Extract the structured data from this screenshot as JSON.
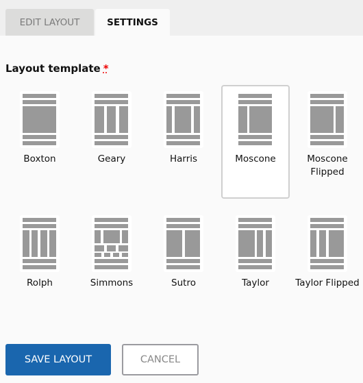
{
  "tabs": [
    {
      "label": "EDIT LAYOUT",
      "active": false
    },
    {
      "label": "SETTINGS",
      "active": true
    }
  ],
  "field": {
    "label": "Layout template",
    "required_mark": "*"
  },
  "templates": [
    {
      "name": "Boxton",
      "selected": false
    },
    {
      "name": "Geary",
      "selected": false
    },
    {
      "name": "Harris",
      "selected": false
    },
    {
      "name": "Moscone",
      "selected": true
    },
    {
      "name": "Moscone Flipped",
      "selected": false
    },
    {
      "name": "Rolph",
      "selected": false
    },
    {
      "name": "Simmons",
      "selected": false
    },
    {
      "name": "Sutro",
      "selected": false
    },
    {
      "name": "Taylor",
      "selected": false
    },
    {
      "name": "Taylor Flipped",
      "selected": false
    }
  ],
  "buttons": {
    "save": "SAVE LAYOUT",
    "cancel": "CANCEL"
  },
  "colors": {
    "primary": "#1a66ae",
    "icon_fill": "#999999",
    "required": "#ee0000"
  }
}
